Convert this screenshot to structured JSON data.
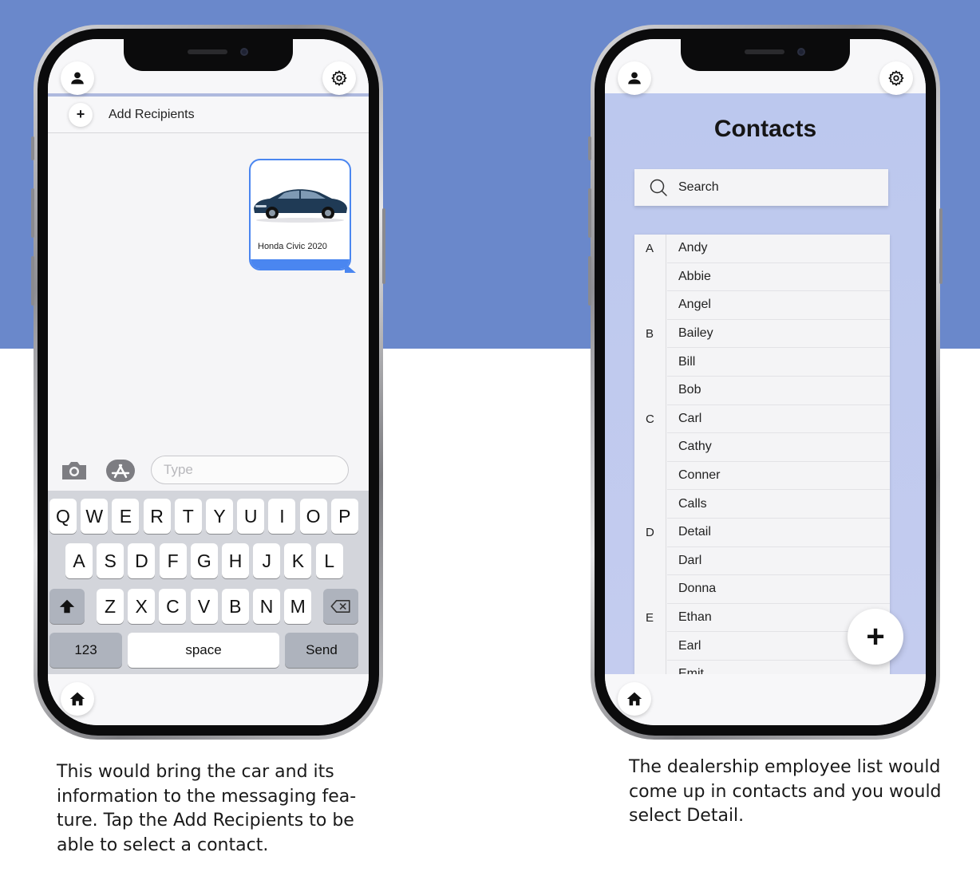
{
  "colors": {
    "background_band": "#6a88cb",
    "accent_blue": "#4a86f0",
    "contacts_bg": "#bcc8ee",
    "keyboard_bg": "#d3d5db"
  },
  "phone1": {
    "topbar": {
      "left_icon": "person-icon",
      "right_icon": "gear-icon"
    },
    "add_recipients": {
      "icon": "+",
      "label": "Add Recipients"
    },
    "message_card": {
      "image": "car-image",
      "label": "Honda Civic 2020"
    },
    "compose": {
      "camera_icon": "camera-icon",
      "apps_icon": "app-store-icon",
      "placeholder": "Type"
    },
    "keyboard": {
      "row1": [
        "Q",
        "W",
        "E",
        "R",
        "T",
        "Y",
        "U",
        "I",
        "O",
        "P"
      ],
      "row2": [
        "A",
        "S",
        "D",
        "F",
        "G",
        "H",
        "J",
        "K",
        "L"
      ],
      "row3": [
        "Z",
        "X",
        "C",
        "V",
        "B",
        "N",
        "M"
      ],
      "shift_icon": "shift-icon",
      "backspace_icon": "backspace-icon",
      "numbers": "123",
      "space": "space",
      "send": "Send"
    },
    "bottombar": {
      "home_icon": "home-icon"
    }
  },
  "phone2": {
    "topbar": {
      "left_icon": "person-icon",
      "right_icon": "gear-icon"
    },
    "title": "Contacts",
    "search": {
      "icon": "search-icon",
      "placeholder": "Search"
    },
    "letters": [
      {
        "letter": "A",
        "row": 0
      },
      {
        "letter": "B",
        "row": 3
      },
      {
        "letter": "C",
        "row": 6
      },
      {
        "letter": "D",
        "row": 10
      },
      {
        "letter": "E",
        "row": 13
      }
    ],
    "contacts": [
      "Andy",
      "Abbie",
      "Angel",
      "Bailey",
      "Bill",
      "Bob",
      "Carl",
      "Cathy",
      "Conner",
      "Calls",
      "Detail",
      "Darl",
      "Donna",
      "Ethan",
      "Earl",
      "Emit"
    ],
    "fab": "+",
    "bottombar": {
      "home_icon": "home-icon"
    }
  },
  "captions": {
    "left": "This would bring the car and its information to the messaging fea-ture. Tap the Add Recipients to be able to select a contact.",
    "right": "The dealership employee list would come up in contacts and you would select Detail."
  }
}
